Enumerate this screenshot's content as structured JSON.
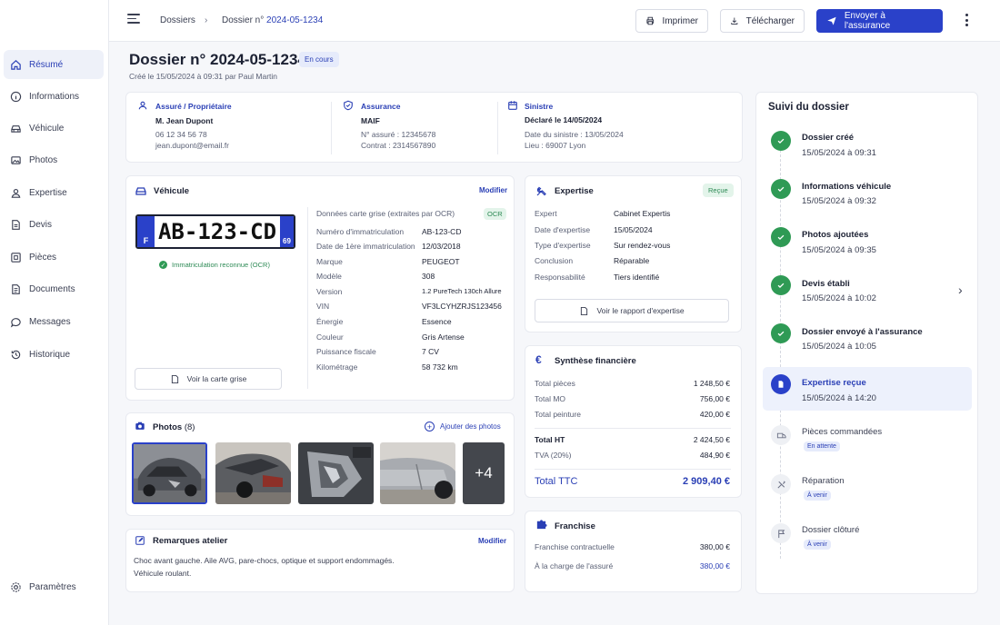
{
  "breadcrumb": {
    "root": "Dossiers",
    "prefix": "Dossier n°",
    "number": "2024-05-1234"
  },
  "toolbar": {
    "print": "Imprimer",
    "download": "Télécharger",
    "send": "Envoyer à l'assurance"
  },
  "sidebar": {
    "items": [
      {
        "label": "Résumé",
        "icon": "home-icon"
      },
      {
        "label": "Informations",
        "icon": "info-icon"
      },
      {
        "label": "Véhicule",
        "icon": "car-icon"
      },
      {
        "label": "Photos",
        "icon": "image-icon"
      },
      {
        "label": "Expertise",
        "icon": "user-icon"
      },
      {
        "label": "Devis",
        "icon": "document-icon"
      },
      {
        "label": "Pièces",
        "icon": "parts-icon"
      },
      {
        "label": "Documents",
        "icon": "file-icon"
      },
      {
        "label": "Messages",
        "icon": "chat-icon"
      },
      {
        "label": "Historique",
        "icon": "history-icon"
      }
    ],
    "settings": "Paramètres"
  },
  "header": {
    "title": "Dossier n° 2024-05-1234",
    "status": "En cours",
    "created": "Créé le 15/05/2024 à 09:31 par Paul Martin"
  },
  "owner": {
    "heading": "Assuré / Propriétaire",
    "name": "M. Jean Dupont",
    "phone": "06 12 34 56 78",
    "email": "jean.dupont@email.fr"
  },
  "insurance": {
    "heading": "Assurance",
    "name": "MAIF",
    "policy": "N° assuré : 12345678",
    "contract": "Contrat : 2314567890"
  },
  "claim": {
    "heading": "Sinistre",
    "declared": "Déclaré le 14/05/2024",
    "date": "Date du sinistre : 13/05/2024",
    "place": "Lieu : 69007 Lyon"
  },
  "vehicle": {
    "title": "Véhicule",
    "edit": "Modifier",
    "plate": "AB-123-CD",
    "plate_country": "F",
    "plate_dept": "69",
    "ocr_ok": "Immatriculation reconnue (OCR)",
    "grey_card": "Voir la carte grise",
    "data_heading": "Données carte grise (extraites par OCR)",
    "ocr_tag": "OCR",
    "fields": [
      {
        "k": "Numéro d'immatriculation",
        "v": "AB-123-CD"
      },
      {
        "k": "Date de 1ère immatriculation",
        "v": "12/03/2018"
      },
      {
        "k": "Marque",
        "v": "PEUGEOT"
      },
      {
        "k": "Modèle",
        "v": "308"
      },
      {
        "k": "Version",
        "v": "1.2 PureTech 130ch Allure"
      },
      {
        "k": "VIN",
        "v": "VF3LCYHZRJS123456"
      },
      {
        "k": "Énergie",
        "v": "Essence"
      },
      {
        "k": "Couleur",
        "v": "Gris Artense"
      },
      {
        "k": "Puissance fiscale",
        "v": "7 CV"
      },
      {
        "k": "Kilométrage",
        "v": "58 732 km"
      }
    ]
  },
  "photos": {
    "title": "Photos",
    "count": "(8)",
    "add": "Ajouter des photos",
    "more": "+4"
  },
  "remarks": {
    "title": "Remarques atelier",
    "edit": "Modifier",
    "line1": "Choc avant gauche. Aile AVG, pare-chocs, optique et support endommagés.",
    "line2": "Véhicule roulant."
  },
  "expertise": {
    "title": "Expertise",
    "status": "Reçue",
    "fields": [
      {
        "k": "Expert",
        "v": "Cabinet Expertis"
      },
      {
        "k": "Date d'expertise",
        "v": "15/05/2024"
      },
      {
        "k": "Type d'expertise",
        "v": "Sur rendez-vous"
      },
      {
        "k": "Conclusion",
        "v": "Réparable"
      },
      {
        "k": "Responsabilité",
        "v": "Tiers identifié"
      }
    ],
    "report": "Voir le rapport d'expertise"
  },
  "finance": {
    "title": "Synthèse financière",
    "rows": [
      {
        "k": "Total pièces",
        "v": "1 248,50 €"
      },
      {
        "k": "Total MO",
        "v": "756,00 €"
      },
      {
        "k": "Total peinture",
        "v": "420,00 €"
      }
    ],
    "ht_label": "Total HT",
    "ht_value": "2 424,50 €",
    "tva_label": "TVA (20%)",
    "tva_value": "484,90 €",
    "ttc_label": "Total TTC",
    "ttc_value": "2 909,40 €"
  },
  "franchise": {
    "title": "Franchise",
    "contract_label": "Franchise contractuelle",
    "contract_value": "380,00 €",
    "charge_label": "À la charge de l'assuré",
    "charge_value": "380,00 €"
  },
  "timeline": {
    "title": "Suivi du dossier",
    "steps": [
      {
        "title": "Dossier créé",
        "time": "15/05/2024 à 09:31",
        "state": "done"
      },
      {
        "title": "Informations véhicule",
        "time": "15/05/2024 à 09:32",
        "state": "done"
      },
      {
        "title": "Photos ajoutées",
        "time": "15/05/2024 à 09:35",
        "state": "done"
      },
      {
        "title": "Devis établi",
        "time": "15/05/2024 à 10:02",
        "state": "done"
      },
      {
        "title": "Dossier envoyé à l'assurance",
        "time": "15/05/2024 à 10:05",
        "state": "done"
      },
      {
        "title": "Expertise reçue",
        "time": "15/05/2024 à 14:20",
        "state": "current"
      },
      {
        "title": "Pièces commandées",
        "tag": "En attente",
        "state": "pending"
      },
      {
        "title": "Réparation",
        "tag": "À venir",
        "state": "pending"
      },
      {
        "title": "Dossier clôturé",
        "tag": "À venir",
        "state": "pending"
      }
    ]
  }
}
